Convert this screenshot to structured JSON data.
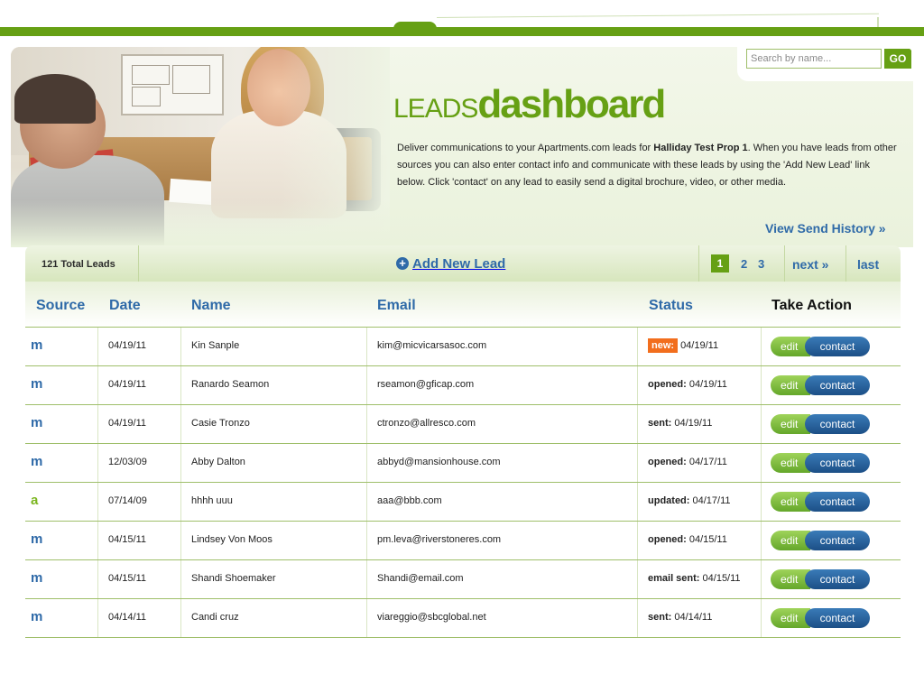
{
  "search": {
    "placeholder": "Search by name...",
    "go_label": "GO"
  },
  "header": {
    "title_part1": "LEADS",
    "title_part2": "dashboard",
    "description_pre": "Deliver communications to your Apartments.com leads for ",
    "property_name": "Halliday Test Prop 1",
    "description_post": ". When you have leads from other sources you can also enter contact info and communicate with these leads by using the 'Add New Lead' link below. Click 'contact' on any lead to easily send a digital brochure, video, or other media.",
    "history_link": "View Send History »"
  },
  "toolbar": {
    "total_leads": "121 Total Leads",
    "add_icon": "+",
    "add_label": "Add New Lead",
    "pages": [
      "1",
      "2",
      "3"
    ],
    "current_page": "1",
    "next_label": "next »",
    "last_label": "last"
  },
  "table": {
    "columns": [
      "Source",
      "Date",
      "Name",
      "Email",
      "Status",
      "Take Action"
    ],
    "edit_label": "edit",
    "contact_label": "contact",
    "rows": [
      {
        "source": "m",
        "date": "04/19/11",
        "name": "Kin Sanple",
        "email": "kim@micvicarsasoc.com",
        "status_label": "new:",
        "status_date": "04/19/11"
      },
      {
        "source": "m",
        "date": "04/19/11",
        "name": "Ranardo Seamon",
        "email": "rseamon@gficap.com",
        "status_label": "opened:",
        "status_date": "04/19/11"
      },
      {
        "source": "m",
        "date": "04/19/11",
        "name": "Casie Tronzo",
        "email": "ctronzo@allresco.com",
        "status_label": "sent:",
        "status_date": "04/19/11"
      },
      {
        "source": "m",
        "date": "12/03/09",
        "name": "Abby Dalton",
        "email": "abbyd@mansionhouse.com",
        "status_label": "opened:",
        "status_date": "04/17/11"
      },
      {
        "source": "a",
        "date": "07/14/09",
        "name": "hhhh uuu",
        "email": "aaa@bbb.com",
        "status_label": "updated:",
        "status_date": "04/17/11"
      },
      {
        "source": "m",
        "date": "04/15/11",
        "name": "Lindsey Von Moos",
        "email": "pm.leva@riverstoneres.com",
        "status_label": "opened:",
        "status_date": "04/15/11"
      },
      {
        "source": "m",
        "date": "04/15/11",
        "name": "Shandi Shoemaker",
        "email": "Shandi@email.com",
        "status_label": "email sent:",
        "status_date": "04/15/11"
      },
      {
        "source": "m",
        "date": "04/14/11",
        "name": "Candi cruz",
        "email": "viareggio@sbcglobal.net",
        "status_label": "sent:",
        "status_date": "04/14/11"
      }
    ]
  },
  "colors": {
    "brand_green": "#66a014",
    "link_blue": "#2f6aa8",
    "badge_orange": "#f26e1d"
  }
}
